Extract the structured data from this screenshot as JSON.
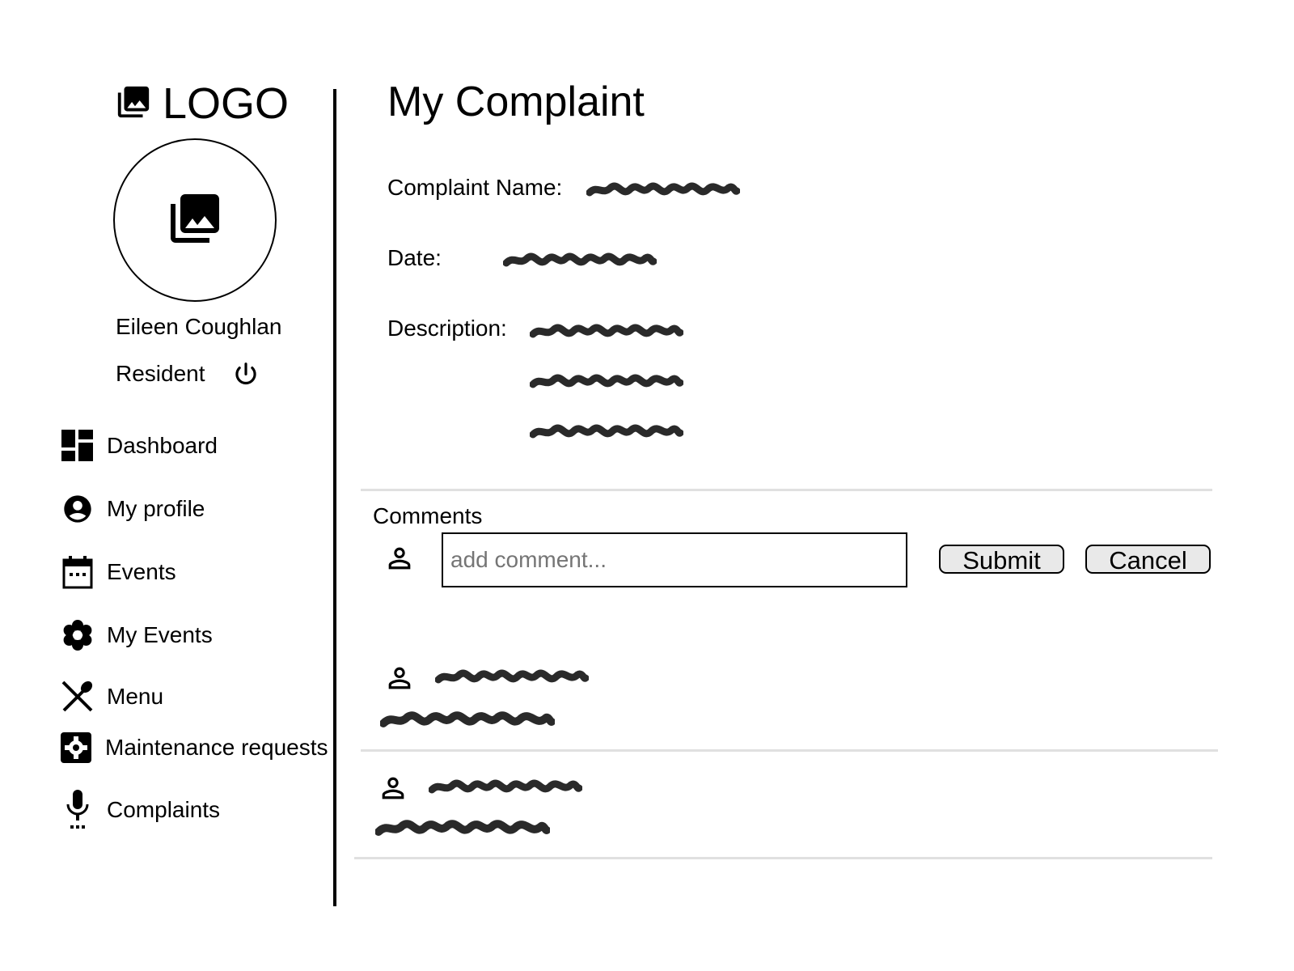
{
  "logo": {
    "text": "LOGO",
    "icon": "photo-library-icon"
  },
  "user": {
    "name": "Eileen Coughlan",
    "role": "Resident",
    "avatar_icon": "photo-library-icon",
    "logout_icon": "power-icon"
  },
  "nav": {
    "items": [
      {
        "label": "Dashboard",
        "icon": "dashboard-icon"
      },
      {
        "label": "My profile",
        "icon": "account-circle-icon"
      },
      {
        "label": "Events",
        "icon": "calendar-icon"
      },
      {
        "label": "My Events",
        "icon": "flower-icon"
      },
      {
        "label": "Menu",
        "icon": "utensils-icon"
      },
      {
        "label": "Maintenance requests",
        "icon": "settings-box-icon"
      },
      {
        "label": "Complaints",
        "icon": "microphone-icon"
      }
    ]
  },
  "main": {
    "title": "My Complaint",
    "fields": {
      "name_label": "Complaint Name:",
      "date_label": "Date:",
      "description_label": "Description:"
    },
    "comments": {
      "label": "Comments",
      "input_placeholder": "add comment...",
      "submit_label": "Submit",
      "cancel_label": "Cancel",
      "user_icon": "person-outline-icon"
    }
  },
  "colors": {
    "text": "#000000",
    "divider": "#e0e0e0",
    "button_bg": "#e9e9e9",
    "scribble": "#2a2a2a"
  }
}
